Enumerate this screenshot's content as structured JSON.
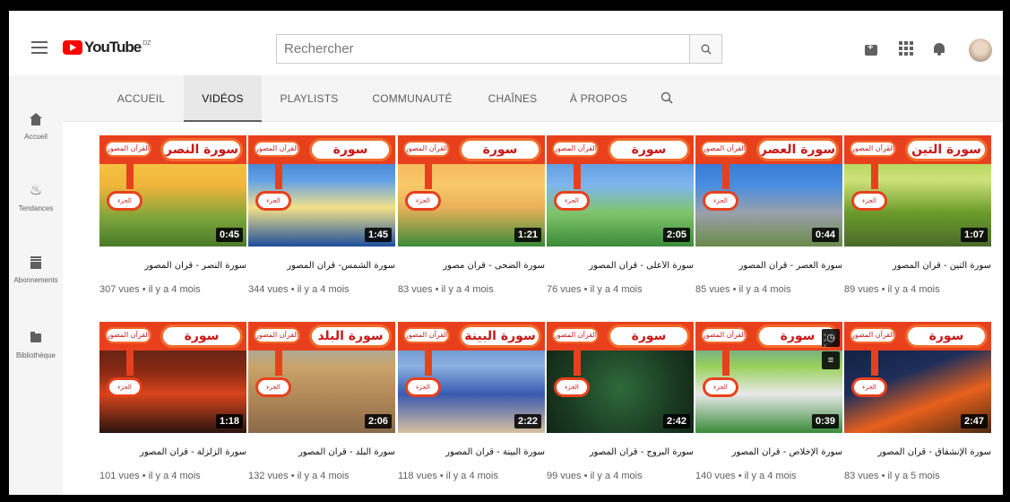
{
  "header": {
    "logo_text": "YouTube",
    "country_code": "DZ",
    "search_placeholder": "Rechercher",
    "icons": [
      "menu-icon",
      "search-icon",
      "create-video-icon",
      "apps-icon",
      "notifications-icon",
      "avatar"
    ]
  },
  "sidebar": {
    "items": [
      {
        "label": "Accueil",
        "icon": "home-icon"
      },
      {
        "label": "Tendances",
        "icon": "flame-icon"
      },
      {
        "label": "Abonnements",
        "icon": "subscriptions-icon"
      },
      {
        "label": "Bibliothèque",
        "icon": "folder-icon"
      }
    ]
  },
  "tabs": [
    {
      "label": "ACCUEIL",
      "active": false
    },
    {
      "label": "VIDÉOS",
      "active": true
    },
    {
      "label": "PLAYLISTS",
      "active": false
    },
    {
      "label": "COMMUNAUTÉ",
      "active": false
    },
    {
      "label": "CHAÎNES",
      "active": false
    },
    {
      "label": "À PROPOS",
      "active": false
    }
  ],
  "thumb_labels": {
    "series": "القرآن المصور",
    "part": "الجزء الثلاثون"
  },
  "videos": [
    {
      "banner": "سورة النصر",
      "duration": "0:45",
      "title": "سورة النصر - قرآن المصور",
      "meta": "307 vues • il y a 4 mois",
      "bg": "linear-gradient(180deg,#f7d14a 0%,#f1b53b 45%,#7aa43a 75%,#4a7a2a 100%)"
    },
    {
      "banner": "سورة الشمس",
      "duration": "1:45",
      "title": "سورة الشمس- قرآن المصور",
      "meta": "344 vues • il y a 4 mois",
      "bg": "linear-gradient(180deg,#2a5fb7 0%,#5fa0e6 40%,#f3e18a 65%,#1e4e9c 100%)"
    },
    {
      "banner": "سورة الضحى",
      "duration": "1:21",
      "title": "سورة الضحى - قرآن مصور",
      "meta": "83 vues • il y a 4 mois",
      "bg": "linear-gradient(180deg,#f4a64a 0%,#f8c96a 45%,#e9b15a 65%,#3a8a3a 100%)"
    },
    {
      "banner": "سورة الأعلى",
      "duration": "2:05",
      "title": "سورة الأعلى - قرآن المصور",
      "meta": "76 vues • il y a 4 mois",
      "bg": "linear-gradient(180deg,#3f7fd1 0%,#7fb6ee 45%,#7fc46a 70%,#3c8a3a 100%)"
    },
    {
      "banner": "سورة العصر",
      "duration": "0:44",
      "title": "سورة العصر - قرآن المصور",
      "meta": "85 vues • il y a 4 mois",
      "bg": "linear-gradient(180deg,#1e64c8 0%,#4a8de0 45%,#9aa0a8 70%,#6a8a4a 100%)"
    },
    {
      "banner": "سورة التين",
      "duration": "1:07",
      "title": "سورة التين - قرآن المصور",
      "meta": "89 vues • il y a 4 mois",
      "bg": "linear-gradient(180deg,#8fc43a 0%,#cfe27a 40%,#6a9a2a 70%,#4a6a2a 100%)"
    },
    {
      "banner": "سورة الزلزلة",
      "duration": "1:18",
      "title": "سورة الزلزلة - قرآن المصور",
      "meta": "101 vues • il y a 4 mois",
      "bg": "linear-gradient(180deg,#3a1a14 0%,#8a2a14 45%,#d8441c 65%,#2a1410 100%)"
    },
    {
      "banner": "سورة البلد",
      "duration": "2:06",
      "title": "سورة البلد - قرآن المصور",
      "meta": "132 vues • il y a 4 mois",
      "bg": "linear-gradient(180deg,#7ab3e0 0%,#c9a46a 40%,#b48a5a 65%,#8a6a4a 100%)"
    },
    {
      "banner": "سورة البينة",
      "duration": "2:22",
      "title": "سورة البينة - قرآن المصور",
      "meta": "118 vues • il y a 4 mois",
      "bg": "linear-gradient(180deg,#4a74c0 0%,#8ab0e0 40%,#3a5ab0 65%,#d8c0a0 100%)"
    },
    {
      "banner": "سورة البروج",
      "duration": "2:42",
      "title": "سورة البروج - قرآن المصور",
      "meta": "99 vues • il y a 4 mois",
      "bg": "radial-gradient(circle at 50% 60%,#2e6a3a 0%,#1a3a22 55%,#0e1e12 100%)"
    },
    {
      "banner": "سورة الإخلاص",
      "duration": "0:39",
      "title": "سورة الإخلاص - قرآن المصور",
      "meta": "140 vues • il y a 4 mois",
      "bg": "linear-gradient(180deg,#3a7ad0 0%,#9ad05a 40%,#e8e8e8 65%,#3a8a3a 100%)"
    },
    {
      "banner": "سورة الإنشقاق",
      "duration": "2:47",
      "title": "سورة الإنشقاق - قرآن المصور",
      "meta": "83 vues • il y a 5 mois",
      "bg": "linear-gradient(160deg,#0e1a3a 0%,#1e2e5a 45%,#e8601c 70%,#4a2a14 100%)"
    }
  ]
}
